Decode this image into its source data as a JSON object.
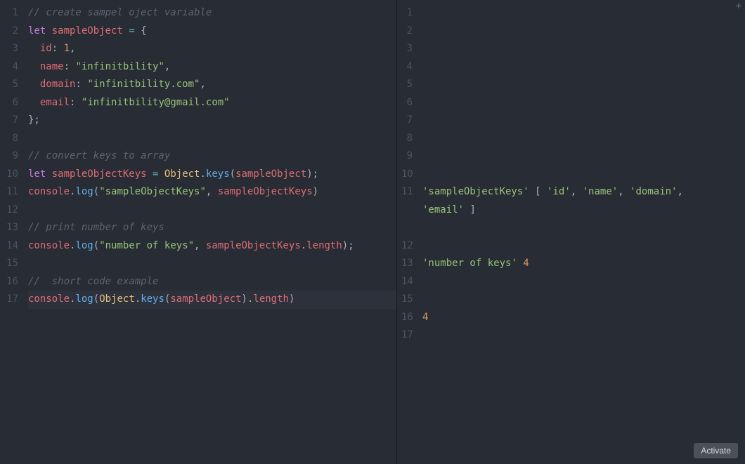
{
  "left": {
    "lineCount": 17,
    "tokens": {
      "l1_c1": "// create sampel oject variable",
      "l2_kw": "let",
      "l2_id": "sampleObject",
      "l2_op": "=",
      "l2_brace": "{",
      "l3_pr": "id",
      "l3_colon": ":",
      "l3_nu": "1",
      "l3_comma": ",",
      "l4_pr": "name",
      "l4_colon": ":",
      "l4_st": "\"infinitbility\"",
      "l4_comma": ",",
      "l5_pr": "domain",
      "l5_colon": ":",
      "l5_st": "\"infinitbility.com\"",
      "l5_comma": ",",
      "l6_pr": "email",
      "l6_colon": ":",
      "l6_st": "\"infinitbility@gmail.com\"",
      "l7_close": "};",
      "l9_c1": "// convert keys to array",
      "l10_kw": "let",
      "l10_id": "sampleObjectKeys",
      "l10_op": "=",
      "l10_cl": "Object",
      "l10_dot1": ".",
      "l10_fn": "keys",
      "l10_p1": "(",
      "l10_arg": "sampleObject",
      "l10_p2": ");",
      "l11_cons": "console",
      "l11_dot": ".",
      "l11_log": "log",
      "l11_p1": "(",
      "l11_st": "\"sampleObjectKeys\"",
      "l11_comma": ",",
      "l11_arg": "sampleObjectKeys",
      "l11_p2": ")",
      "l13_c1": "// print number of keys",
      "l14_cons": "console",
      "l14_dot": ".",
      "l14_log": "log",
      "l14_p1": "(",
      "l14_st": "\"number of keys\"",
      "l14_comma": ",",
      "l14_arg": "sampleObjectKeys",
      "l14_dot2": ".",
      "l14_len": "length",
      "l14_p2": ");",
      "l16_c1": "//  short code example",
      "l17_cons": "console",
      "l17_dot": ".",
      "l17_log": "log",
      "l17_p1": "(",
      "l17_cl": "Object",
      "l17_dot2": ".",
      "l17_fn": "keys",
      "l17_p2": "(",
      "l17_arg": "sampleObject",
      "l17_p3": ")",
      "l17_dot3": ".",
      "l17_len": "length",
      "l17_p4": ")"
    }
  },
  "right": {
    "lineNumbers": [
      "1",
      "2",
      "3",
      "4",
      "5",
      "6",
      "7",
      "8",
      "9",
      "10",
      "11",
      "12",
      "13",
      "14",
      "15",
      "16",
      "17"
    ],
    "out11_a": "'sampleObjectKeys'",
    "out11_br1": "[",
    "out11_v1": "'id'",
    "out11_c1": ",",
    "out11_v2": "'name'",
    "out11_c2": ",",
    "out11_v3": "'domain'",
    "out11_c3": ",",
    "out11_v4": "'email'",
    "out11_br2": "]",
    "out14_a": "'number of keys'",
    "out14_b": "4",
    "out17_a": "4"
  },
  "activate_label": "Activate"
}
